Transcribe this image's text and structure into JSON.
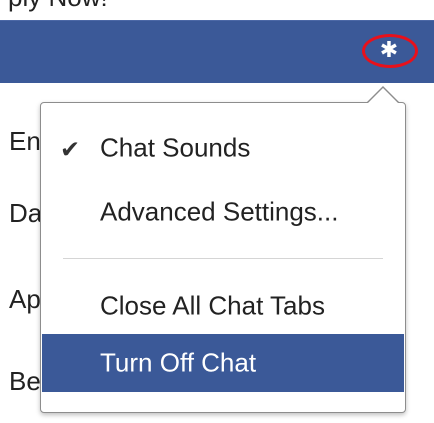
{
  "header": {
    "partial_text": "ply Now!",
    "settings_icon": "gear-icon",
    "bar_color": "#3b5998",
    "highlight_color": "#e8111b"
  },
  "background_list": {
    "items": [
      "En",
      "Da",
      "Ap",
      "Be"
    ]
  },
  "menu": {
    "items": [
      {
        "label": "Chat Sounds",
        "checked": true
      },
      {
        "label": "Advanced Settings..."
      },
      {
        "label": "Close All Chat Tabs"
      },
      {
        "label": "Turn Off Chat",
        "highlighted": true
      }
    ],
    "check_icon": "check-icon",
    "highlight_color": "#3b5998"
  }
}
